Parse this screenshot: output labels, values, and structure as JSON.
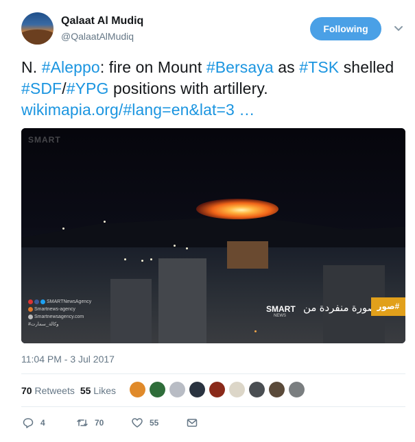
{
  "author": {
    "display_name": "Qalaat Al Mudiq",
    "screen_name": "@QalaatAlMudiq",
    "avatar_icon": "profile-photo"
  },
  "follow_button": {
    "label": "Following",
    "color": "#4aa0e6"
  },
  "menu_icon": "chevron-down-icon",
  "tweet": {
    "parts": [
      {
        "text": "N. ",
        "link": false
      },
      {
        "text": "#Aleppo",
        "link": true
      },
      {
        "text": ": fire on Mount ",
        "link": false
      },
      {
        "text": "#Bersaya",
        "link": true
      },
      {
        "text": " as ",
        "link": false
      },
      {
        "text": "#TSK",
        "link": true
      },
      {
        "text": " shelled ",
        "link": false
      },
      {
        "text": "#SDF",
        "link": true
      },
      {
        "text": "/",
        "link": false
      },
      {
        "text": "#YPG",
        "link": true
      },
      {
        "text": " positions with artillery. ",
        "link": false
      },
      {
        "text": "wikimapia.org/#lang=en&lat=3 …",
        "link": true
      }
    ],
    "link_color": "#1b95e0"
  },
  "media": {
    "watermark": "SMART",
    "social_lines": [
      "SMARTNewsAgency",
      "Smartnews-agency",
      "Smartnewsagency.com",
      "#وكالة_سمارت"
    ],
    "logo_text": "SMART",
    "logo_sub": "NEWS",
    "exclusive_text": "صورة منفردة من",
    "tag_text": "#صور"
  },
  "timestamp": "11:04 PM - 3 Jul 2017",
  "stats": {
    "retweets_count": "70",
    "retweets_label": "Retweets",
    "likes_count": "55",
    "likes_label": "Likes"
  },
  "likers_colors": [
    "#e08a2a",
    "#2f6d3a",
    "#b8bcc4",
    "#2a3340",
    "#8a2a1a",
    "#dcd6c8",
    "#4a4e52",
    "#5a4a3a",
    "#7a7e80"
  ],
  "actions": {
    "reply_count": "4",
    "retweet_count": "70",
    "like_count": "55",
    "reply_icon": "reply-icon",
    "retweet_icon": "retweet-icon",
    "like_icon": "heart-icon",
    "dm_icon": "envelope-icon"
  }
}
